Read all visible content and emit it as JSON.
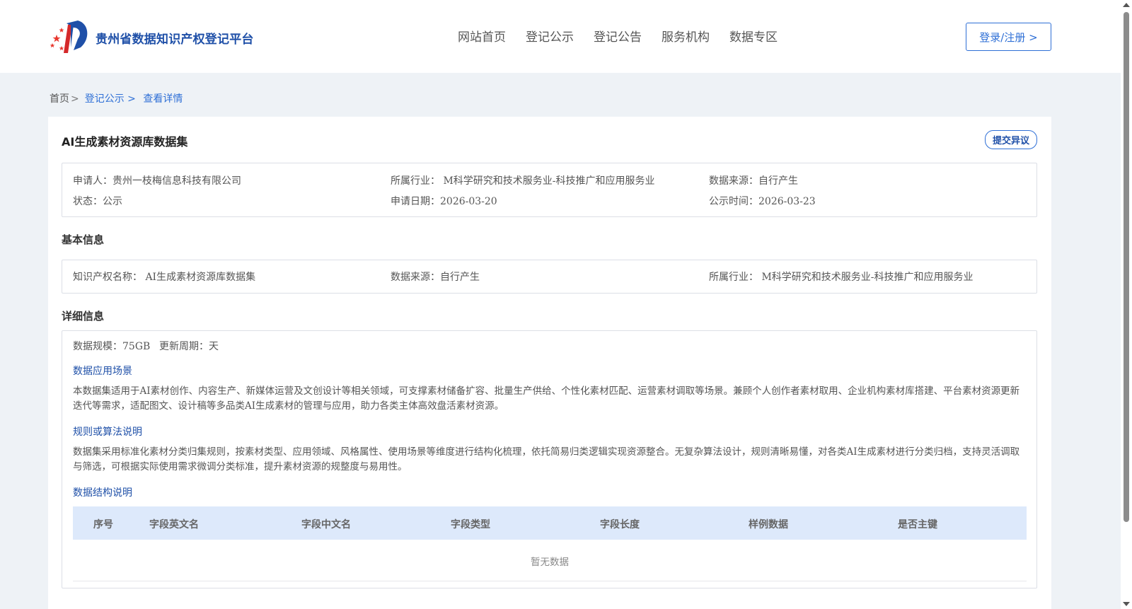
{
  "header": {
    "site_title": "贵州省数据知识产权登记平台",
    "nav": [
      "网站首页",
      "登记公示",
      "登记公告",
      "服务机构",
      "数据专区"
    ],
    "login_label": "登录/注册 >"
  },
  "breadcrumb": {
    "home": "首页",
    "sep": ">",
    "items": [
      "登记公示 >",
      "查看详情"
    ]
  },
  "detail": {
    "title": "AI生成素材资源库数据集",
    "objection_label": "提交异议",
    "summary": {
      "applicant": "申请人：贵州一枝梅信息科技有限公司",
      "industry": "所属行业： M科学研究和技术服务业-科技推广和应用服务业",
      "source": "数据来源：自行产生",
      "status": "状态：公示",
      "apply_date": "申请日期：2026-03-20",
      "publish_date": "公示时间：2026-03-23"
    },
    "basic": {
      "heading": "基本信息",
      "ip_name": "知识产权名称： AI生成素材资源库数据集",
      "source": "数据来源：自行产生",
      "industry": "所属行业： M科学研究和技术服务业-科技推广和应用服务业"
    },
    "detail_info": {
      "heading": "详细信息",
      "scale": "数据规模：75GB",
      "cycle": "更新周期：天",
      "scenario_title": "数据应用场景",
      "scenario_text": "本数据集适用于AI素材创作、内容生产、新媒体运营及文创设计等相关领域，可支撑素材储备扩容、批量生产供给、个性化素材匹配、运营素材调取等场景。兼顾个人创作者素材取用、企业机构素材库搭建、平台素材资源更新迭代等需求，适配图文、设计稿等多品类AI生成素材的管理与应用，助力各类主体高效盘活素材资源。",
      "rules_title": "规则或算法说明",
      "rules_text": "数据集采用标准化素材分类归集规则，按素材类型、应用领域、风格属性、使用场景等维度进行结构化梳理，依托简易归类逻辑实现资源整合。无复杂算法设计，规则清晰易懂，对各类AI生成素材进行分类归档，支持灵活调取与筛选，可根据实际使用需求微调分类标准，提升素材资源的规整度与易用性。",
      "structure_title": "数据结构说明",
      "table_headers": [
        "序号",
        "字段英文名",
        "字段中文名",
        "字段类型",
        "字段长度",
        "样例数据",
        "是否主键"
      ],
      "empty_text": "暂无数据"
    }
  },
  "colors": {
    "brand_blue": "#1f50a8",
    "link_blue": "#2e6fd6",
    "page_bg": "#eef2f6",
    "table_head_bg": "#dde9fb"
  },
  "icons": [
    "logo-emblem-icon",
    "scroll-up-icon",
    "scroll-down-icon"
  ]
}
